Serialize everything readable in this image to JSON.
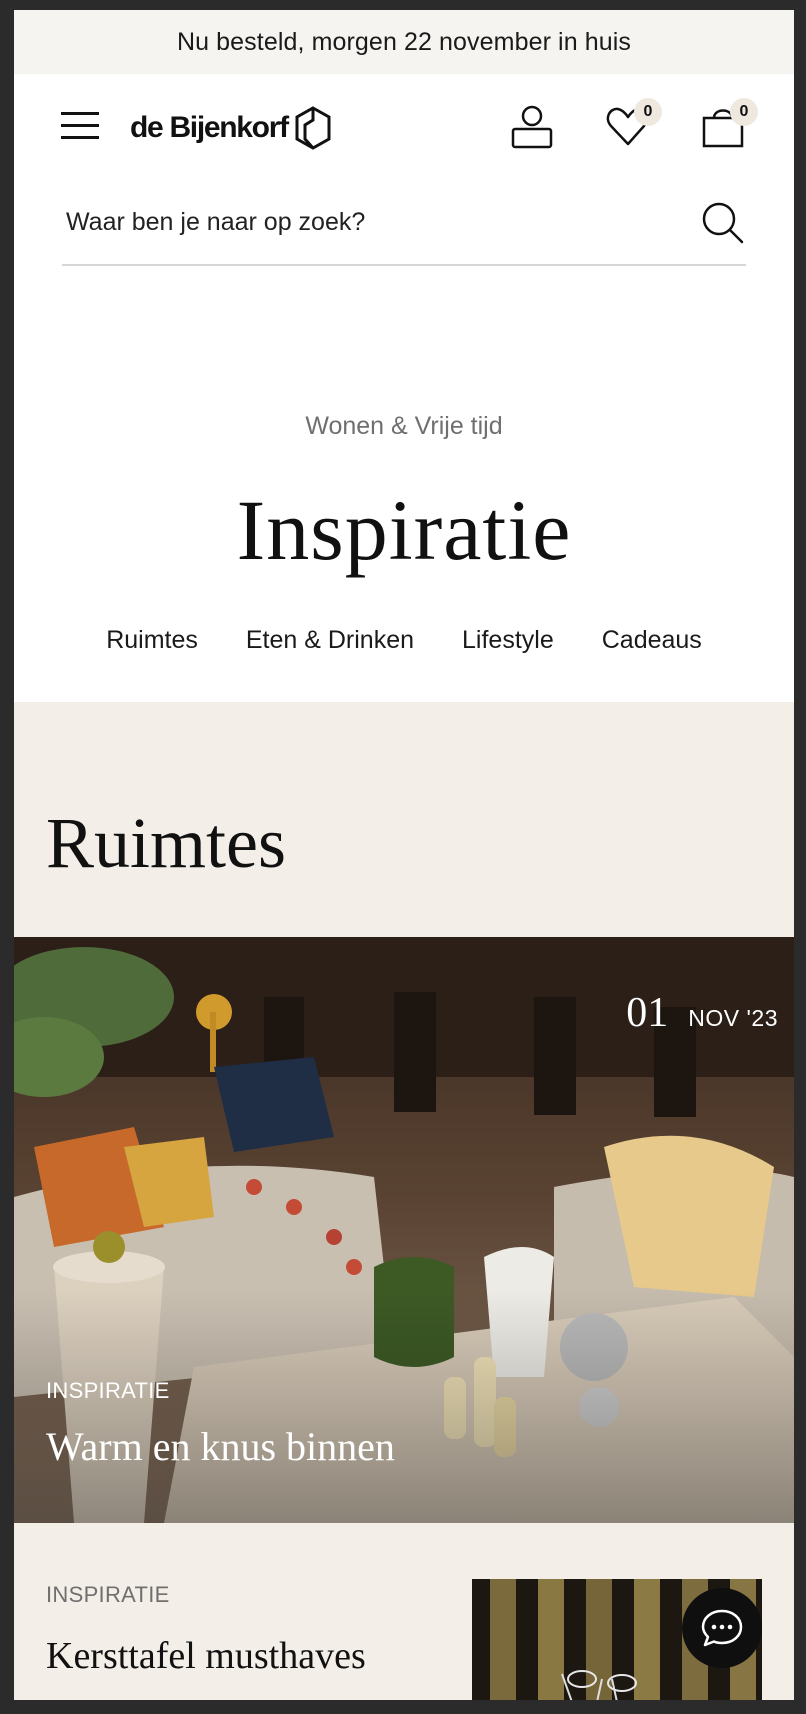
{
  "promo": {
    "text": "Nu besteld, morgen 22 november in huis"
  },
  "header": {
    "logo_text": "de Bijenkorf",
    "wishlist_count": "0",
    "cart_count": "0"
  },
  "search": {
    "placeholder": "Waar ben je naar op zoek?"
  },
  "hero": {
    "eyebrow": "Wonen & Vrije tijd",
    "title": "Inspiratie",
    "categories": [
      "Ruimtes",
      "Eten & Drinken",
      "Lifestyle",
      "Cadeaus"
    ]
  },
  "section": {
    "title": "Ruimtes",
    "featured": {
      "day": "01",
      "month_year": "NOV '23",
      "label": "INSPIRATIE",
      "title": "Warm en knus binnen"
    },
    "second": {
      "label": "INSPIRATIE",
      "title": "Kersttafel musthaves"
    }
  },
  "colors": {
    "promo_bg": "#f5f4f1",
    "section_bg": "#f4eee8",
    "badge_bg": "#efe8df",
    "chat_bg": "#0f0f0f"
  },
  "icons": [
    "menu-icon",
    "bijenkorf-logo-icon",
    "account-icon",
    "heart-icon",
    "bag-icon",
    "search-icon",
    "chat-icon"
  ]
}
